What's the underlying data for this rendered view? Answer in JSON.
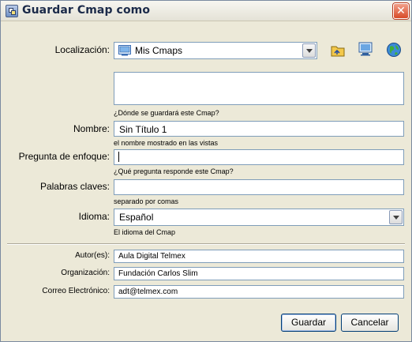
{
  "window": {
    "title": "Guardar Cmap como",
    "close_glyph": "✕"
  },
  "colors": {
    "dialog_bg": "#ece9d8",
    "field_border": "#7f9db9",
    "close_red": "#d84a28"
  },
  "location": {
    "label": "Localización:",
    "value": "Mis Cmaps",
    "value_icon": "cmap-folder-icon",
    "hint": "¿Dónde se guardará este Cmap?",
    "toolbar_icons": [
      "folder-up-icon",
      "monitor-icon",
      "globe-icon"
    ]
  },
  "name": {
    "label": "Nombre:",
    "value": "Sin Título 1",
    "hint": "el nombre mostrado en las vistas"
  },
  "focus_question": {
    "label": "Pregunta de enfoque:",
    "value": "",
    "hint": "¿Qué pregunta responde este Cmap?"
  },
  "keywords": {
    "label": "Palabras claves:",
    "value": "",
    "hint": "separado por comas"
  },
  "language": {
    "label": "Idioma:",
    "value": "Español",
    "hint": "El idioma del Cmap"
  },
  "authors": {
    "label": "Autor(es):",
    "value": "Aula Digital Telmex"
  },
  "organization": {
    "label": "Organización:",
    "value": "Fundación Carlos Slim"
  },
  "email": {
    "label": "Correo Electrónico:",
    "value": "adt@telmex.com"
  },
  "buttons": {
    "save": "Guardar",
    "cancel": "Cancelar"
  }
}
